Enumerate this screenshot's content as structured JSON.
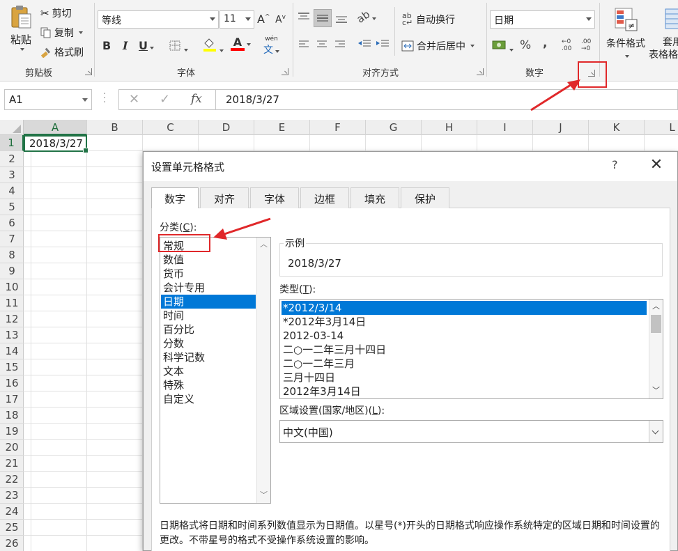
{
  "ribbon": {
    "clipboard": {
      "group_label": "剪贴板",
      "paste": "粘贴",
      "cut": "剪切",
      "copy": "复制",
      "format_painter": "格式刷"
    },
    "font": {
      "group_label": "字体",
      "font_name": "等线",
      "font_size": "11",
      "bold": "B",
      "italic": "I",
      "underline": "U",
      "grow": "A",
      "shrink": "A",
      "wen": "wén",
      "wen_char": "文"
    },
    "alignment": {
      "group_label": "对齐方式",
      "wrap_text": "自动换行",
      "merge_center": "合并后居中"
    },
    "number": {
      "group_label": "数字",
      "number_format": "日期",
      "percent": "%",
      "comma": ",",
      "inc_decimal": ".00",
      "dec_decimal": ".00"
    },
    "styles": {
      "conditional_format": "条件格式",
      "format_table_line1": "套用",
      "format_table_line2": "表格格"
    }
  },
  "formula_bar": {
    "name_box": "A1",
    "cancel": "✕",
    "enter": "✓",
    "fx": "fx",
    "value": "2018/3/27"
  },
  "sheet": {
    "columns": [
      "A",
      "B",
      "C",
      "D",
      "E",
      "F",
      "G",
      "H",
      "I",
      "J",
      "K",
      "L"
    ],
    "rows": [
      "1",
      "2",
      "3",
      "4",
      "5",
      "6",
      "7",
      "8",
      "9",
      "10",
      "11",
      "12",
      "13",
      "14",
      "15",
      "16",
      "17",
      "18",
      "19",
      "20",
      "21",
      "22",
      "23",
      "24",
      "25",
      "26"
    ],
    "cell_a1": "2018/3/27"
  },
  "dialog": {
    "title": "设置单元格格式",
    "help": "?",
    "close": "✕",
    "tabs": [
      "数字",
      "对齐",
      "字体",
      "边框",
      "填充",
      "保护"
    ],
    "category_label": "分类(",
    "category_label_key": "C",
    "category_label_end": "):",
    "categories": [
      "常规",
      "数值",
      "货币",
      "会计专用",
      "日期",
      "时间",
      "百分比",
      "分数",
      "科学记数",
      "文本",
      "特殊",
      "自定义"
    ],
    "sample_label": "示例",
    "sample_value": "2018/3/27",
    "type_label": "类型(",
    "type_label_key": "T",
    "type_label_end": "):",
    "types": [
      "*2012/3/14",
      "*2012年3月14日",
      "2012-03-14",
      "二○一二年三月十四日",
      "二○一二年三月",
      "三月十四日",
      "2012年3月14日"
    ],
    "locale_label": "区域设置(国家/地区)(",
    "locale_label_key": "L",
    "locale_label_end": "):",
    "locale_value": "中文(中国)",
    "description": "日期格式将日期和时间系列数值显示为日期值。以星号(*)开头的日期格式响应操作系统特定的区域日期和时间设置的更改。不带星号的格式不受操作系统设置的影响。"
  },
  "colors": {
    "accent": "#217346",
    "selection": "#0078d7",
    "annotation": "#e0282a"
  }
}
